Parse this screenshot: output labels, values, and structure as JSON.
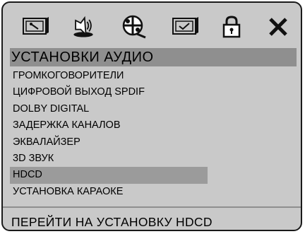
{
  "icons": [
    "wrench-setup-icon",
    "speaker-audio-icon",
    "film-reel-video-icon",
    "checkbox-preference-icon",
    "lock-icon",
    "close-icon"
  ],
  "header": {
    "title": "УСТАНОВКИ АУДИО"
  },
  "menu": {
    "items": [
      {
        "label": "ГРОМКОГОВОРИТЕЛИ"
      },
      {
        "label": "ЦИФРОВОЙ ВЫХОД SPDIF"
      },
      {
        "label": "DOLBY DIGITAL"
      },
      {
        "label": "ЗАДЕРЖКА КАНАЛОВ"
      },
      {
        "label": "ЭКВАЛАЙЗЕР"
      },
      {
        "label": "3D ЗВУК"
      },
      {
        "label": "HDCD"
      },
      {
        "label": "УСТАНОВКА КАРАОКЕ"
      }
    ],
    "selected": "HDCD"
  },
  "status": {
    "text": "ПЕРЕЙТИ НА УСТАНОВКУ HDCD"
  },
  "colors": {
    "background": "#c9c9c9",
    "header": "#8f8f8f",
    "selected_row": "#9b9b9b"
  }
}
